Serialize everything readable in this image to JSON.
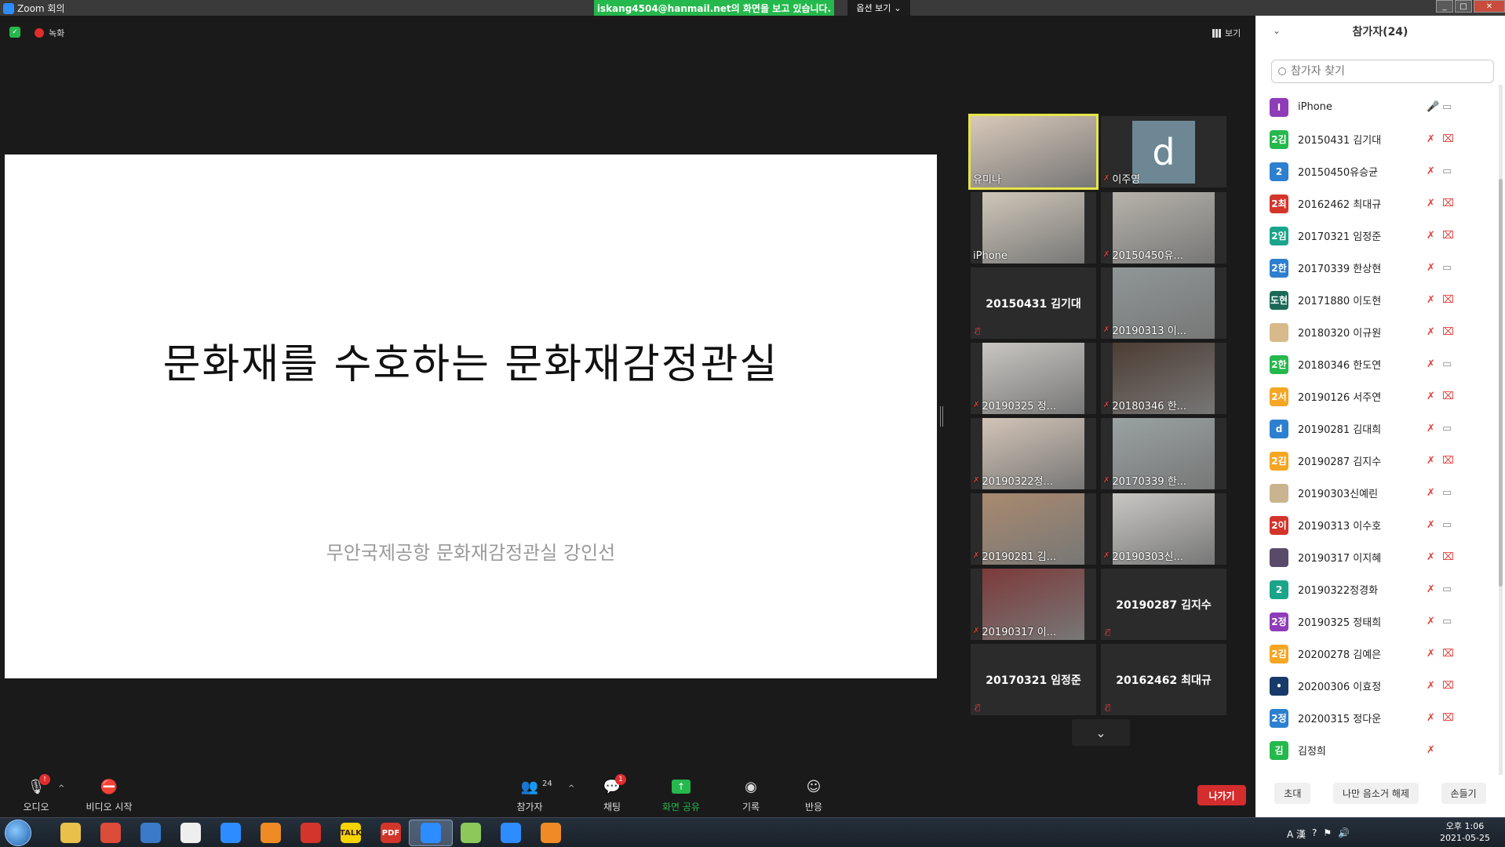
{
  "window": {
    "title": "Zoom 회의"
  },
  "banner": {
    "share_text": "iskang4504@hanmail.net의 화면을 보고 있습니다.",
    "view_options": "옵션 보기"
  },
  "meeting": {
    "recording_label": "녹화",
    "view_label": "보기"
  },
  "slide": {
    "title": "문화재를 수호하는 문화재감정관실",
    "subtitle": "무안국제공항 문화재감정관실 강인선"
  },
  "tiles": [
    {
      "name": "유미나",
      "kind": "photo",
      "muted": false,
      "active": true,
      "color": "#d9c9b9"
    },
    {
      "name": "이주영",
      "kind": "avatar",
      "letter": "d",
      "muted": true
    },
    {
      "name": "iPhone",
      "kind": "photo",
      "muted": false,
      "color": "#cfc7b8"
    },
    {
      "name": "20150450유...",
      "kind": "photo",
      "muted": true,
      "color": "#b7b3ab"
    },
    {
      "name": "20150431 김기대",
      "kind": "text",
      "muted": true
    },
    {
      "name": "20190313 이...",
      "kind": "photo",
      "muted": true,
      "color": "#8f9796"
    },
    {
      "name": "20190325 정...",
      "kind": "photo",
      "muted": true,
      "color": "#c9c6c2"
    },
    {
      "name": "20180346 한...",
      "kind": "photo",
      "muted": true,
      "color": "#4d3d33"
    },
    {
      "name": "20190322정...",
      "kind": "photo",
      "muted": true,
      "color": "#d3c4b6"
    },
    {
      "name": "20170339 한...",
      "kind": "photo",
      "muted": true,
      "color": "#9aa2a2"
    },
    {
      "name": "20190281 김...",
      "kind": "photo",
      "muted": true,
      "color": "#a98a6e"
    },
    {
      "name": "20190303신...",
      "kind": "photo",
      "muted": true,
      "color": "#c8c7c4"
    },
    {
      "name": "20190317 이...",
      "kind": "photo",
      "muted": true,
      "color": "#7d3a3a"
    },
    {
      "name": "20190287 김지수",
      "kind": "text",
      "muted": true
    },
    {
      "name": "20170321 임정준",
      "kind": "text",
      "muted": true
    },
    {
      "name": "20162462 최대규",
      "kind": "text",
      "muted": true
    }
  ],
  "toolbar": {
    "audio": "오디오",
    "audio_badge": "!",
    "video": "비디오 시작",
    "participants": "참가자",
    "participants_count": "24",
    "chat": "채팅",
    "chat_badge": "1",
    "share": "화면 공유",
    "record": "기록",
    "reactions": "반응",
    "leave": "나가기"
  },
  "panel": {
    "title": "참가자(24)",
    "search_placeholder": "참가자 찾기",
    "participants": [
      {
        "initials": "I",
        "name": "iPhone",
        "color": "#8e3cb8",
        "mic_on": true,
        "cam_on": true
      },
      {
        "initials": "2김",
        "name": "20150431 김기대",
        "color": "#25b84c",
        "mic_on": false,
        "cam_on": false
      },
      {
        "initials": "2",
        "name": "20150450유승균",
        "color": "#2d7fcf",
        "mic_on": false,
        "cam_on": true
      },
      {
        "initials": "2최",
        "name": "20162462 최대규",
        "color": "#d3352b",
        "mic_on": false,
        "cam_on": false
      },
      {
        "initials": "2임",
        "name": "20170321 임정준",
        "color": "#1aa58a",
        "mic_on": false,
        "cam_on": false
      },
      {
        "initials": "2한",
        "name": "20170339 한상현",
        "color": "#2d7fcf",
        "mic_on": false,
        "cam_on": true
      },
      {
        "initials": "도현",
        "name": "20171880 이도현",
        "color": "#1a6a57",
        "mic_on": false,
        "cam_on": false
      },
      {
        "initials": "",
        "name": "20180320 이규원",
        "color": "#d8b98a",
        "mic_on": false,
        "cam_on": false
      },
      {
        "initials": "2한",
        "name": "20180346 한도연",
        "color": "#25b84c",
        "mic_on": false,
        "cam_on": true
      },
      {
        "initials": "2서",
        "name": "20190126 서주연",
        "color": "#f5a623",
        "mic_on": false,
        "cam_on": false
      },
      {
        "initials": "d",
        "name": "20190281 김대희",
        "color": "#2d7fcf",
        "mic_on": false,
        "cam_on": true
      },
      {
        "initials": "2김",
        "name": "20190287 김지수",
        "color": "#f5a623",
        "mic_on": false,
        "cam_on": false
      },
      {
        "initials": "",
        "name": "20190303신예린",
        "color": "#c9b48f",
        "mic_on": false,
        "cam_on": true
      },
      {
        "initials": "2이",
        "name": "20190313 이수호",
        "color": "#d3352b",
        "mic_on": false,
        "cam_on": true
      },
      {
        "initials": "",
        "name": "20190317 이지혜",
        "color": "#5a4a6a",
        "mic_on": false,
        "cam_on": false
      },
      {
        "initials": "2",
        "name": "20190322정경화",
        "color": "#1aa58a",
        "mic_on": false,
        "cam_on": true
      },
      {
        "initials": "2정",
        "name": "20190325 정태희",
        "color": "#8e3cb8",
        "mic_on": false,
        "cam_on": true
      },
      {
        "initials": "2김",
        "name": "20200278 김예은",
        "color": "#f5a623",
        "mic_on": false,
        "cam_on": false
      },
      {
        "initials": "•",
        "name": "20200306 이효정",
        "color": "#173a6a",
        "mic_on": false,
        "cam_on": false
      },
      {
        "initials": "2정",
        "name": "20200315 정다운",
        "color": "#2d7fcf",
        "mic_on": false,
        "cam_on": false
      },
      {
        "initials": "김",
        "name": "김정희",
        "color": "#25b84c",
        "mic_on": false,
        "cam_on": null
      }
    ],
    "footer": {
      "invite": "초대",
      "unmute_me": "나만 음소거 해제",
      "raise_hand": "손들기"
    }
  },
  "taskbar": {
    "apps": [
      {
        "name": "explorer",
        "color": "#e8c04a",
        "label": ""
      },
      {
        "name": "chrome",
        "color": "#dd4b39",
        "label": ""
      },
      {
        "name": "app3",
        "color": "#3a7ac8",
        "label": ""
      },
      {
        "name": "app4",
        "color": "#eeeeee",
        "label": ""
      },
      {
        "name": "ie",
        "color": "#2d8cff",
        "label": ""
      },
      {
        "name": "media",
        "color": "#f08a24",
        "label": ""
      },
      {
        "name": "app7",
        "color": "#d3352b",
        "label": ""
      },
      {
        "name": "kakaotalk",
        "color": "#f7d300",
        "label": "TALK"
      },
      {
        "name": "pdf",
        "color": "#d3352b",
        "label": "PDF"
      },
      {
        "name": "zoom",
        "color": "#2d8cff",
        "label": ""
      },
      {
        "name": "folder",
        "color": "#8cc85a",
        "label": ""
      },
      {
        "name": "ie2",
        "color": "#2d8cff",
        "label": ""
      },
      {
        "name": "alarm",
        "color": "#f08a24",
        "label": ""
      }
    ],
    "clock_time": "오후 1:06",
    "clock_date": "2021-05-25"
  }
}
